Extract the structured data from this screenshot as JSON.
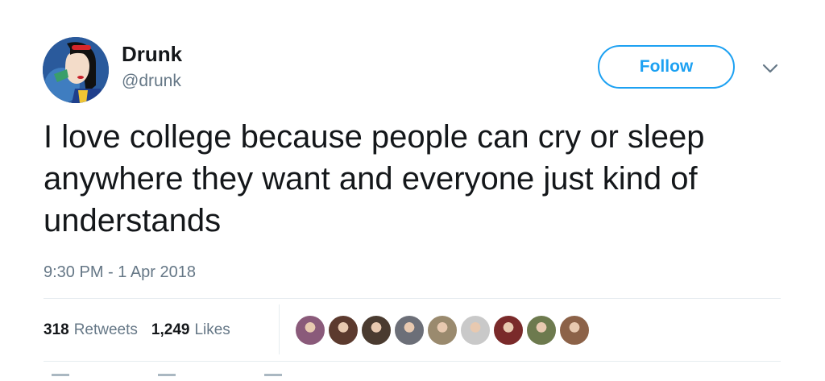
{
  "author": {
    "display_name": "Drunk",
    "handle": "@drunk",
    "avatar_icon": "cartoon-princess-avatar"
  },
  "actions": {
    "follow_label": "Follow",
    "caret_icon": "chevron-down-icon"
  },
  "tweet": {
    "text": "I love college because people can cry or sleep anywhere they want and everyone just kind of understands",
    "timestamp": "9:30 PM - 1 Apr 2018"
  },
  "stats": {
    "retweets_count": "318",
    "retweets_label": "Retweets",
    "likes_count": "1,249",
    "likes_label": "Likes"
  },
  "likers": [
    {
      "name": "liker-avatar-1",
      "color": "#8a5a7a"
    },
    {
      "name": "liker-avatar-2",
      "color": "#5c3a2e"
    },
    {
      "name": "liker-avatar-3",
      "color": "#4a3b30"
    },
    {
      "name": "liker-avatar-4",
      "color": "#6c6f78"
    },
    {
      "name": "liker-avatar-5",
      "color": "#9a8a6e"
    },
    {
      "name": "liker-avatar-6",
      "color": "#c9c9c9"
    },
    {
      "name": "liker-avatar-7",
      "color": "#7a2a2a"
    },
    {
      "name": "liker-avatar-8",
      "color": "#6d7a4e"
    },
    {
      "name": "liker-avatar-9",
      "color": "#8c6248"
    }
  ],
  "colors": {
    "accent": "#1da1f2",
    "secondary_text": "#657786",
    "primary_text": "#14171a",
    "border": "#e6ecf0"
  }
}
